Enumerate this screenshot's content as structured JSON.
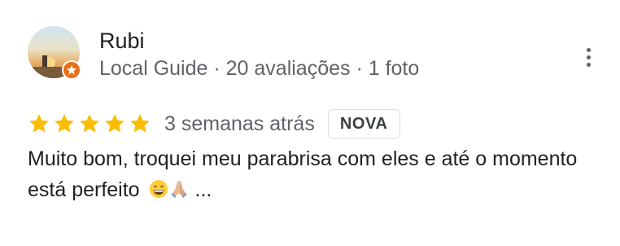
{
  "reviewer": {
    "name": "Rubi",
    "meta": "Local Guide · 20 avaliações · 1 foto",
    "avatar_icon": "profile-photo-sunset-icon",
    "badge_icon": "local-guide-star-icon",
    "badge_color": "#e8711c"
  },
  "rating": {
    "stars": 5,
    "star_color": "#fbbc04",
    "date": "3 semanas atrás",
    "badge_label": "NOVA"
  },
  "review": {
    "text": "Muito bom, troquei meu parabrisa com eles e até o momento está perfeito",
    "emojis": [
      "grinning-face-icon",
      "folded-hands-icon"
    ],
    "more_label": "..."
  },
  "menu": {
    "icon": "more-vertical-icon"
  }
}
